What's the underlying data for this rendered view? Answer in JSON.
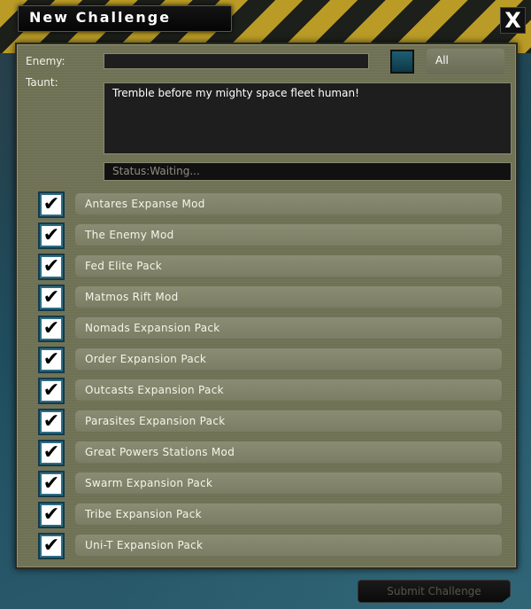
{
  "window": {
    "title": "New Challenge",
    "close_label": "X"
  },
  "form": {
    "enemy_label": "Enemy:",
    "enemy_value": "",
    "taunt_label": "Taunt:",
    "taunt_value": "Tremble before my mighty space fleet human!",
    "all_label": "All",
    "status_text": "Status:Waiting...",
    "color_button_color": "#14495a"
  },
  "mods": [
    {
      "label": "Antares Expanse Mod",
      "checked": true
    },
    {
      "label": "The Enemy Mod",
      "checked": true
    },
    {
      "label": "Fed Elite Pack",
      "checked": true
    },
    {
      "label": "Matmos Rift Mod",
      "checked": true
    },
    {
      "label": "Nomads Expansion Pack",
      "checked": true
    },
    {
      "label": "Order Expansion Pack",
      "checked": true
    },
    {
      "label": "Outcasts Expansion Pack",
      "checked": true
    },
    {
      "label": "Parasites Expansion Pack",
      "checked": true
    },
    {
      "label": "Great Powers Stations Mod",
      "checked": true
    },
    {
      "label": "Swarm Expansion Pack",
      "checked": true
    },
    {
      "label": "Tribe Expansion Pack",
      "checked": true
    },
    {
      "label": "Uni-T Expansion Pack",
      "checked": true
    }
  ],
  "check_glyph": "✔",
  "submit_label": "Submit Challenge",
  "colors": {
    "panel": "#6f7155",
    "hazard_yellow": "#caa522",
    "background_teal": "#1d4a5a"
  }
}
